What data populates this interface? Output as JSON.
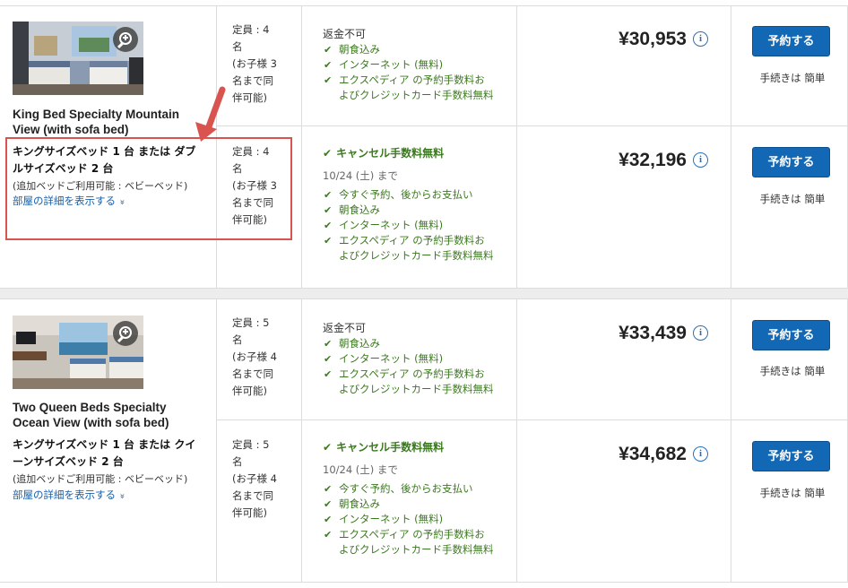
{
  "rooms": [
    {
      "name": "King Bed Specialty Mountain View (with sofa bed)",
      "bed": "キングサイズベッド 1 台 または ダブルサイズベッド 2 台",
      "extra_bed": "(追加ベッドご利用可能 : ベビーベッド)",
      "detail_link": "部屋の詳細を表示する",
      "rates": [
        {
          "occupancy": [
            "定員 : 4",
            "名",
            "(お子様 3",
            "名まで同",
            "伴可能)"
          ],
          "policy": "返金不可",
          "cancel_date": "",
          "features": [
            "朝食込み",
            "インターネット (無料)",
            "エクスペディア の予約手数料お",
            "よびクレジットカード手数料無料"
          ],
          "price": "¥30,953",
          "book_label": "予約する",
          "easy_label": "手続きは 簡単"
        },
        {
          "occupancy": [
            "定員 : 4",
            "名",
            "(お子様 3",
            "名まで同",
            "伴可能)"
          ],
          "policy": "キャンセル手数料無料",
          "cancel_date": "10/24 (土) まで",
          "features": [
            "今すぐ予約、後からお支払い",
            "朝食込み",
            "インターネット (無料)",
            "エクスペディア の予約手数料お",
            "よびクレジットカード手数料無料"
          ],
          "price": "¥32,196",
          "book_label": "予約する",
          "easy_label": "手続きは 簡単"
        }
      ]
    },
    {
      "name": "Two Queen Beds Specialty Ocean View (with sofa bed)",
      "bed": "キングサイズベッド 1 台 または クイーンサイズベッド 2 台",
      "extra_bed": "(追加ベッドご利用可能 : ベビーベッド)",
      "detail_link": "部屋の詳細を表示する",
      "rates": [
        {
          "occupancy": [
            "定員 : 5",
            "名",
            "(お子様 4",
            "名まで同",
            "伴可能)"
          ],
          "policy": "返金不可",
          "cancel_date": "",
          "features": [
            "朝食込み",
            "インターネット (無料)",
            "エクスペディア の予約手数料お",
            "よびクレジットカード手数料無料"
          ],
          "price": "¥33,439",
          "book_label": "予約する",
          "easy_label": "手続きは 簡単"
        },
        {
          "occupancy": [
            "定員 : 5",
            "名",
            "(お子様 4",
            "名まで同",
            "伴可能)"
          ],
          "policy": "キャンセル手数料無料",
          "cancel_date": "10/24 (土) まで",
          "features": [
            "今すぐ予約、後からお支払い",
            "朝食込み",
            "インターネット (無料)",
            "エクスペディア の予約手数料お",
            "よびクレジットカード手数料無料"
          ],
          "price": "¥34,682",
          "book_label": "予約する",
          "easy_label": "手続きは 簡単"
        }
      ]
    }
  ],
  "icons": {
    "zoom": "magnifier-plus-icon",
    "info": "info-circle-icon",
    "check": "check-icon",
    "expand": "double-chevron-down-icon",
    "annotation": "arrow-annotation-icon"
  },
  "colors": {
    "book_button": "#1368b5",
    "link": "#1a5fa8",
    "green": "#3b7a1e",
    "highlight": "#d9534f"
  },
  "glyphs": {
    "info": "i",
    "check": "✔",
    "chevron": "»"
  }
}
